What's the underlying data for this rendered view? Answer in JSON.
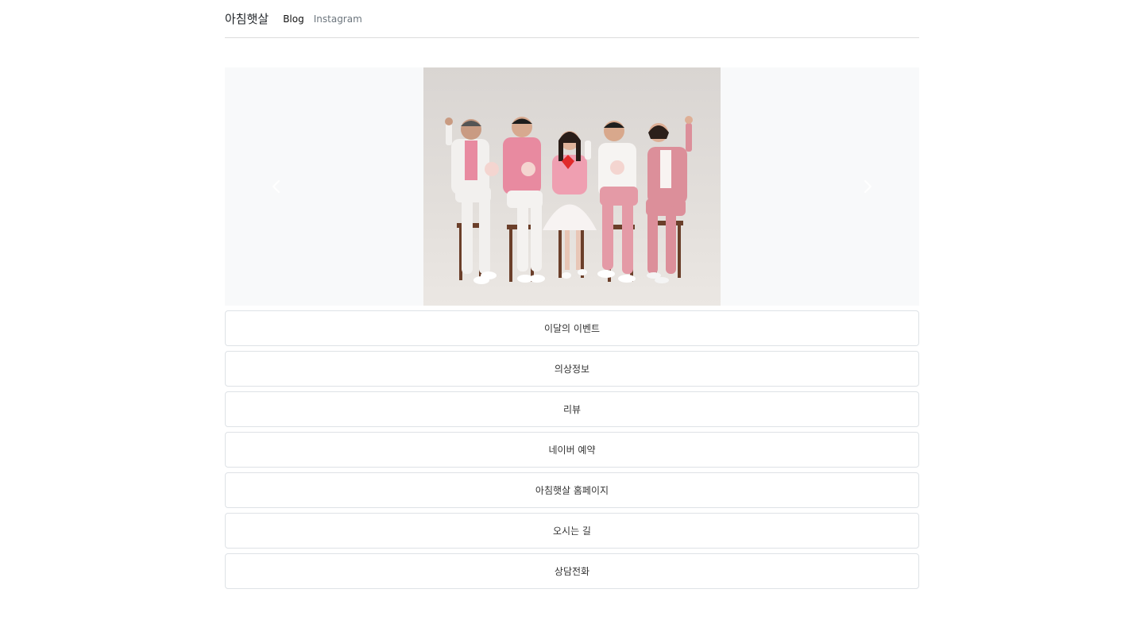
{
  "navbar": {
    "brand": "아침햇살",
    "links": [
      {
        "label": "Blog",
        "active": true
      },
      {
        "label": "Instagram",
        "active": false
      }
    ]
  },
  "carousel": {
    "background": "#f8f9fa",
    "image": "family-photo-in-pink-and-white-outfits",
    "controls": [
      "chevron-left-icon",
      "chevron-right-icon"
    ]
  },
  "menu": {
    "items": [
      {
        "label": "이달의 이벤트"
      },
      {
        "label": "의상정보"
      },
      {
        "label": "리뷰"
      },
      {
        "label": "네이버 예약"
      },
      {
        "label": "아침햇살 홈페이지"
      },
      {
        "label": "오시는 길"
      },
      {
        "label": "상담전화"
      }
    ]
  },
  "colors": {
    "border": "#dee2e6",
    "divider": "#dcdcdc",
    "muted_text": "#6c757d",
    "photo_backdrop": "#dcd8d4",
    "pink_outfit": "#e88aa0"
  }
}
